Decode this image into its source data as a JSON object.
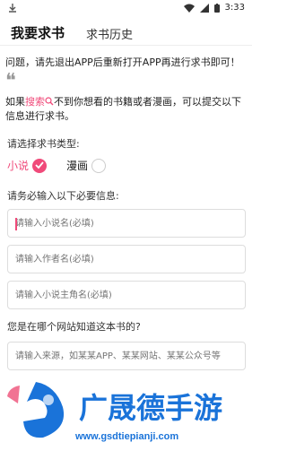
{
  "status": {
    "time": "3:33"
  },
  "tabs": [
    {
      "label": "我要求书",
      "active": true
    },
    {
      "label": "求书历史",
      "active": false
    }
  ],
  "notice": "问题，请先退出APP后重新打开APP再进行求书即可！",
  "description": {
    "prefix": "如果",
    "link": "搜索",
    "suffix": "不到你想看的书籍或者漫画，可以提交以下信息进行求书。"
  },
  "book_type": {
    "label": "请选择求书类型:",
    "options": [
      {
        "label": "小说",
        "selected": true
      },
      {
        "label": "漫画",
        "selected": false
      }
    ]
  },
  "required_info": {
    "label": "请务必输入以下必要信息:",
    "fields": [
      {
        "placeholder": "请输入小说名(必填)"
      },
      {
        "placeholder": "请输入作者名(必填)"
      },
      {
        "placeholder": "请输入小说主角名(必填)"
      }
    ]
  },
  "source": {
    "label": "您是在哪个网站知道这本书的?",
    "placeholder": "请输入来源，如某某APP、某某网站、某某公众号等"
  },
  "watermark": {
    "brand": "广晟德手游",
    "url": "www.gsdtiepianji.com"
  },
  "colors": {
    "accent": "#f04a7a",
    "watermark": "#1a73d9"
  }
}
